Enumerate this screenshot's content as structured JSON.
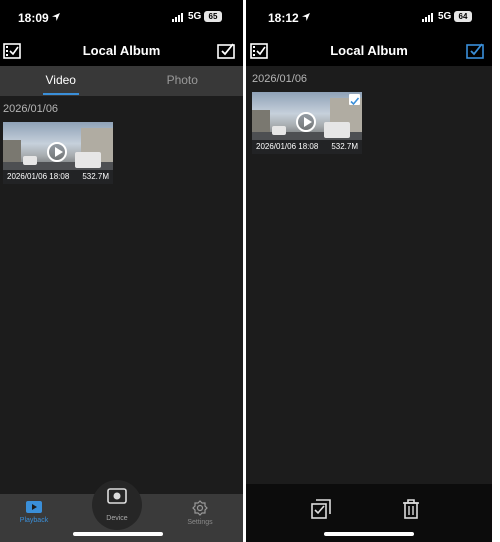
{
  "left": {
    "status": {
      "time": "18:09",
      "network": "5G",
      "battery": "65"
    },
    "header": {
      "title": "Local Album"
    },
    "tabs": [
      {
        "label": "Video"
      },
      {
        "label": "Photo"
      }
    ],
    "date_group": "2026/01/06",
    "video": {
      "date": "2026/01/06 18:08",
      "size": "532.7M"
    },
    "nav": {
      "playback": "Playback",
      "device": "Device",
      "settings": "Settings"
    }
  },
  "right": {
    "status": {
      "time": "18:12",
      "network": "5G",
      "battery": "64"
    },
    "header": {
      "title": "Local Album"
    },
    "date_group": "2026/01/06",
    "video": {
      "date": "2026/01/06 18:08",
      "size": "532.7M"
    }
  },
  "colors": {
    "accent": "#3a8fd9",
    "background": "#1c1c1c",
    "bar": "#000000",
    "tabbar": "#383838"
  }
}
